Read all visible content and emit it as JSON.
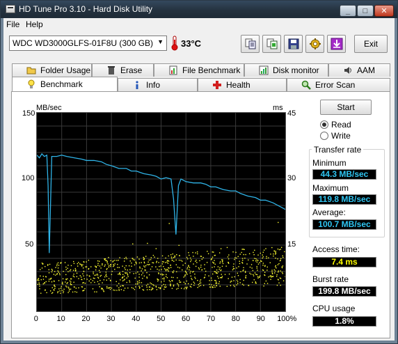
{
  "window": {
    "title": "HD Tune Pro 3.10 - Hard Disk Utility",
    "buttons": {
      "minimize": "_",
      "maximize": "□",
      "close": "✕"
    }
  },
  "menu": {
    "file": "File",
    "help": "Help"
  },
  "toolbar": {
    "drive": "WDC WD3000GLFS-01F8U (300 GB)",
    "temperature": "33°C",
    "exit_label": "Exit",
    "icons": [
      "copy-text-icon",
      "copy-screenshot-icon",
      "save-icon",
      "settings-icon",
      "download-icon"
    ]
  },
  "tabs": {
    "row1": [
      "Folder Usage",
      "Erase",
      "File Benchmark",
      "Disk monitor",
      "AAM"
    ],
    "row2": [
      "Benchmark",
      "Info",
      "Health",
      "Error Scan"
    ],
    "active": "Benchmark"
  },
  "controls": {
    "start_label": "Start",
    "read_label": "Read",
    "write_label": "Write",
    "selected_mode": "Read"
  },
  "stats": {
    "transfer_rate_title": "Transfer rate",
    "minimum_label": "Minimum",
    "minimum_value": "44.3 MB/sec",
    "maximum_label": "Maximum",
    "maximum_value": "119.8 MB/sec",
    "average_label": "Average:",
    "average_value": "100.7 MB/sec",
    "access_time_label": "Access time:",
    "access_time_value": "7.4 ms",
    "burst_rate_label": "Burst rate",
    "burst_rate_value": "199.8 MB/sec",
    "cpu_usage_label": "CPU usage",
    "cpu_usage_value": "1.8%"
  },
  "colors": {
    "transfer_line": "#2fb4e8",
    "access_points": "#ffff33",
    "plot_background": "#000000",
    "grid": "#3a3a3a"
  },
  "chart_data": {
    "type": "line",
    "ylabel": "MB/sec",
    "y2label": "ms",
    "ylim": [
      0,
      150
    ],
    "y2lim": [
      0,
      45
    ],
    "yticks": [
      "150",
      "100",
      "50"
    ],
    "y2ticks": [
      "45",
      "30",
      "15"
    ],
    "xticks": [
      "0",
      "10",
      "20",
      "30",
      "40",
      "50",
      "60",
      "70",
      "80",
      "90",
      "100%"
    ],
    "grid": true,
    "series": [
      {
        "kind": "line",
        "x": [
          0,
          1,
          2,
          3,
          4,
          4.5,
          5,
          5.5,
          6,
          8,
          10,
          12,
          15,
          18,
          20,
          23,
          26,
          28,
          30,
          33,
          36,
          38,
          40,
          43,
          46,
          48,
          50,
          52,
          54,
          55,
          56,
          57,
          58,
          60,
          63,
          66,
          68,
          70,
          72,
          75,
          78,
          80,
          82,
          85,
          88,
          90,
          92,
          95,
          98,
          100
        ],
        "y": [
          118,
          116,
          119,
          117,
          118,
          95,
          44,
          80,
          117,
          117,
          118,
          117,
          116,
          115,
          114,
          114,
          113,
          111,
          110,
          108,
          108,
          106,
          106,
          104,
          103,
          102,
          100,
          101,
          100,
          85,
          58,
          95,
          100,
          98,
          97,
          97,
          96,
          94,
          94,
          92,
          91,
          91,
          89,
          87,
          86,
          84,
          84,
          82,
          79,
          77
        ]
      },
      {
        "kind": "scatter",
        "axis": "right",
        "x_range": [
          0,
          100
        ],
        "y_band_start": [
          4,
          11
        ],
        "y_band_end": [
          6,
          15
        ],
        "count": 900
      }
    ]
  }
}
